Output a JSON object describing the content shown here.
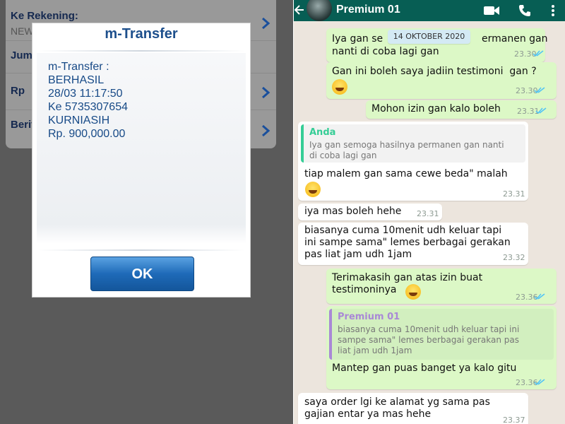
{
  "left": {
    "form": {
      "rows": [
        {
          "label": "Ke Rekening:",
          "value": "NEW"
        },
        {
          "label": "Jum",
          "value": ""
        },
        {
          "label": "Rp",
          "value": ""
        },
        {
          "label": "Berit",
          "value": ""
        }
      ]
    },
    "dialog": {
      "title": "m-Transfer",
      "lines": [
        "m-Transfer :",
        "BERHASIL",
        "28/03 11:17:50",
        "Ke 5735307654",
        "KURNIASIH",
        "Rp. 900,000.00"
      ],
      "ok_label": "OK"
    }
  },
  "right": {
    "header": {
      "name": "Premium 01"
    },
    "date_pill": "14 OKTOBER 2020",
    "messages": [
      {
        "dir": "out",
        "text": "Iya gan se",
        "text2": "ermanen gan",
        "line2": "nanti di coba lagi gan",
        "time": "23.30"
      },
      {
        "dir": "out",
        "text": "Gan ini boleh saya jadiin testimoni  gan ?",
        "time": "23.30"
      },
      {
        "dir": "out",
        "text": "Mohon izin gan kalo boleh",
        "time": "23.31"
      },
      {
        "dir": "in",
        "quote_name": "Anda",
        "quote_text": "Iya gan semoga hasilnya permanen gan nanti\ndi coba lagi gan",
        "text": "tiap malem gan sama cewe beda\" malah",
        "time": "23.31"
      },
      {
        "dir": "in",
        "text": "iya mas boleh hehe",
        "time": "23.31"
      },
      {
        "dir": "in",
        "text": "biasanya cuma 10menit udh keluar tapi\nini sampe sama\" lemes berbagai gerakan\npas liat jam udh 1jam",
        "time": "23.32"
      },
      {
        "dir": "out",
        "text": "Terimakasih gan atas izin buat\ntestimoninya",
        "time": "23.36"
      },
      {
        "dir": "out",
        "quote_name": "Premium 01",
        "quote_text": "biasanya cuma 10menit udh keluar tapi ini\nsampe sama\" lemes berbagai gerakan pas\nliat jam udh 1jam",
        "text": "Mantep gan puas banget ya kalo gitu",
        "time": "23.36"
      },
      {
        "dir": "in",
        "text": "saya order lgi ke alamat yg sama pas\ngajian entar ya mas hehe",
        "time": "23.37"
      }
    ]
  },
  "colors": {
    "whatsapp_header": "#075e54",
    "outgoing": "#dcf8c6",
    "incoming": "#ffffff",
    "chat_bg": "#ece5dd",
    "ok_button": "#1e6ab8",
    "dialog_title": "#1d4f8c"
  }
}
